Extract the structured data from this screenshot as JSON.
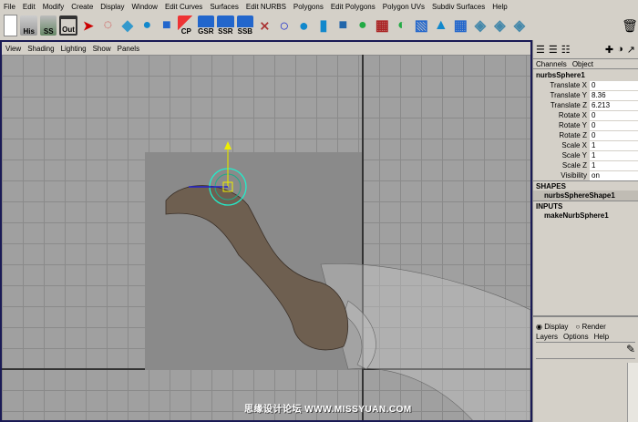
{
  "menubar": [
    "File",
    "Edit",
    "Modify",
    "Create",
    "Display",
    "Window",
    "Edit Curves",
    "Surfaces",
    "Edit NURBS",
    "Polygons",
    "Edit Polygons",
    "Polygon UVs",
    "Subdiv Surfaces",
    "Help"
  ],
  "shelf": {
    "his": "His",
    "ss": "SS",
    "out": "Out",
    "cp": "CP",
    "gsr": "GSR",
    "ssr": "SSR",
    "ssb": "SSB"
  },
  "viewport_menu": [
    "View",
    "Shading",
    "Lighting",
    "Show",
    "Panels"
  ],
  "channel_box": {
    "tabs": [
      "Channels",
      "Object"
    ],
    "object": "nurbsSphere1",
    "attributes": [
      {
        "label": "Translate X",
        "value": "0"
      },
      {
        "label": "Translate Y",
        "value": "8.36"
      },
      {
        "label": "Translate Z",
        "value": "6.213"
      },
      {
        "label": "Rotate X",
        "value": "0"
      },
      {
        "label": "Rotate Y",
        "value": "0"
      },
      {
        "label": "Rotate Z",
        "value": "0"
      },
      {
        "label": "Scale X",
        "value": "1"
      },
      {
        "label": "Scale Y",
        "value": "1"
      },
      {
        "label": "Scale Z",
        "value": "1"
      },
      {
        "label": "Visibility",
        "value": "on"
      }
    ],
    "shapes_header": "SHAPES",
    "shape": "nurbsSphereShape1",
    "inputs_header": "INPUTS",
    "input": "makeNurbSphere1"
  },
  "layers": {
    "display": "Display",
    "render": "Render",
    "menu": [
      "Layers",
      "Options",
      "Help"
    ]
  },
  "watermark": "思缘设计论坛  WWW.MISSYUAN.COM"
}
